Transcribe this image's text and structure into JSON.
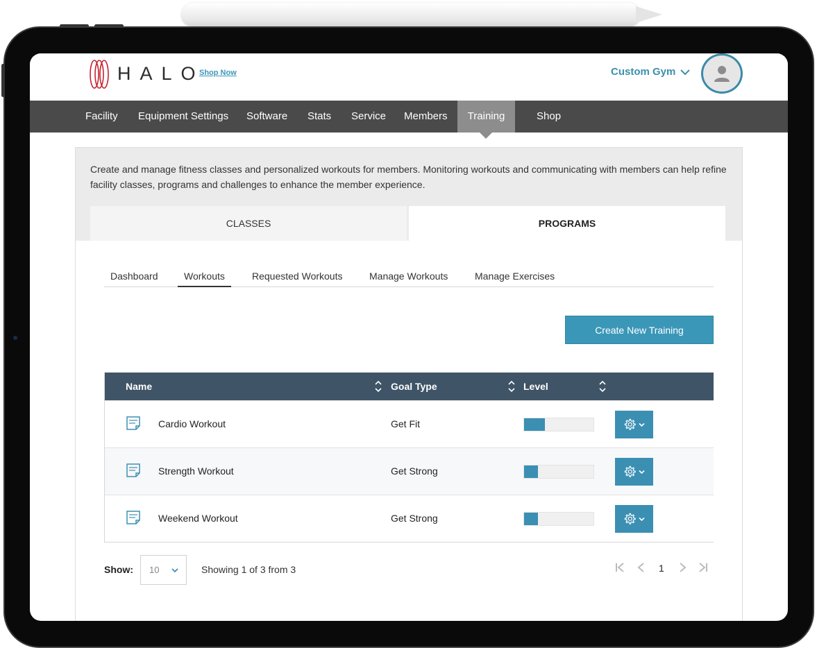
{
  "app": {
    "logo_text": "HALO",
    "shop_link": "Shop Now",
    "gym_selector": "Custom Gym"
  },
  "nav": {
    "items": [
      "Facility",
      "Equipment Settings",
      "Software",
      "Stats",
      "Service",
      "Members",
      "Training",
      "Shop"
    ],
    "active": "Training"
  },
  "intro": "Create and manage fitness classes and personalized workouts for members. Monitoring workouts and communicating with members can help refine facility classes, programs and challenges to enhance the member experience.",
  "main_tabs": {
    "classes": "CLASSES",
    "programs": "PROGRAMS",
    "active": "PROGRAMS"
  },
  "sub_tabs": {
    "items": [
      "Dashboard",
      "Workouts",
      "Requested Workouts",
      "Manage Workouts",
      "Manage Exercises"
    ],
    "active": "Workouts"
  },
  "create_button": "Create New Training",
  "table": {
    "columns": [
      "Name",
      "Goal Type",
      "Level"
    ],
    "rows": [
      {
        "name": "Cardio Workout",
        "goal": "Get Fit",
        "level": 0.3
      },
      {
        "name": "Strength Workout",
        "goal": "Get Strong",
        "level": 0.2
      },
      {
        "name": "Weekend Workout",
        "goal": "Get Strong",
        "level": 0.2
      }
    ]
  },
  "pagination": {
    "show_label": "Show:",
    "page_size": "10",
    "summary": "Showing 1 of 3 from 3",
    "current_page": "1"
  },
  "colors": {
    "accent": "#3b97b8",
    "nav_bg": "#4a4a4a",
    "nav_active": "#8d8d8d",
    "table_header": "#3f5466",
    "logo_red": "#c8202f"
  }
}
